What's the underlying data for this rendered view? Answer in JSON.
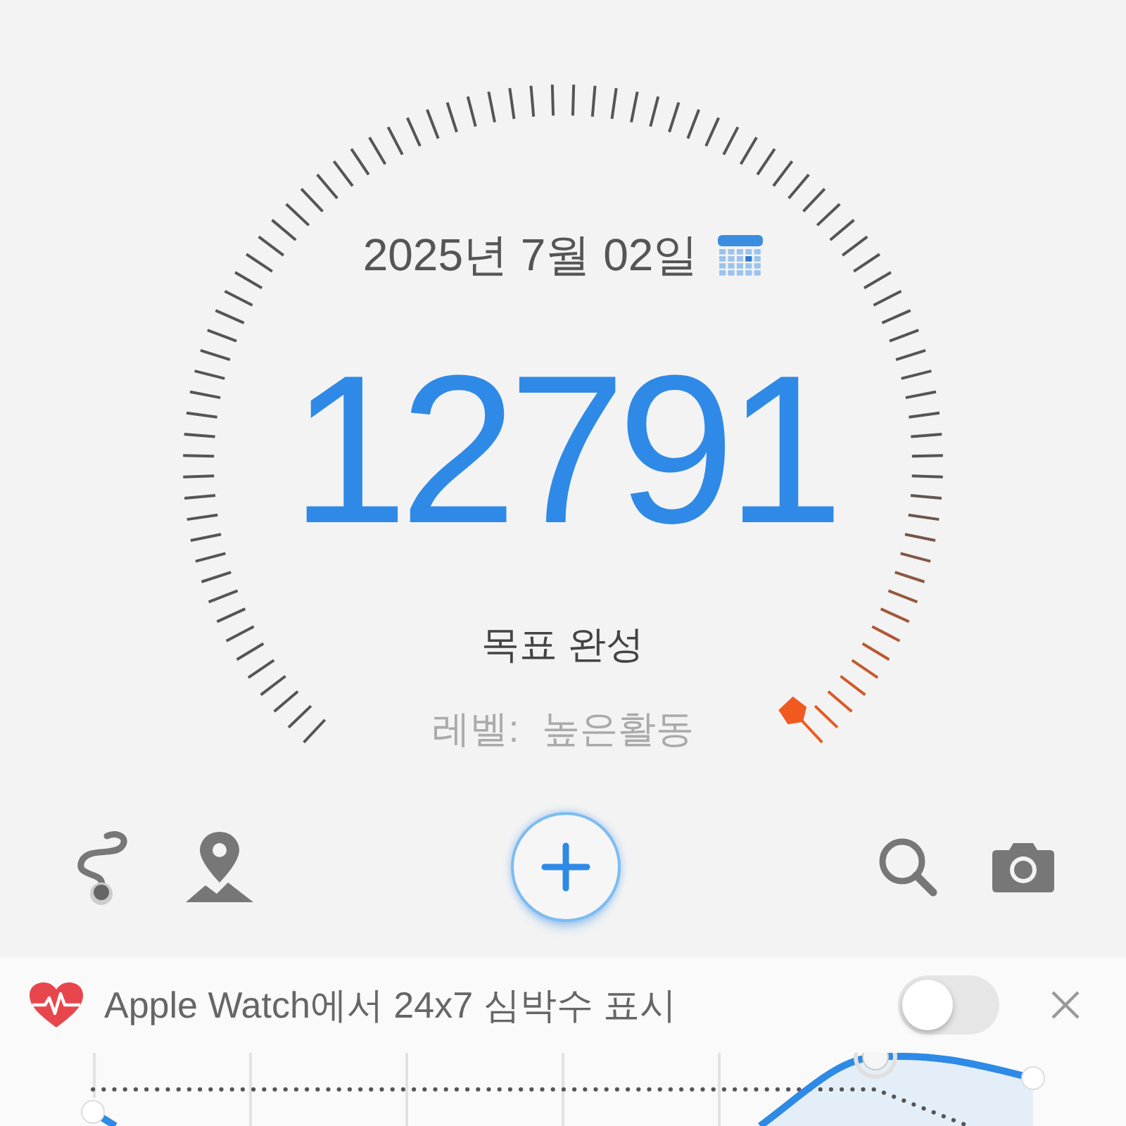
{
  "gauge": {
    "date": "2025년 7월 02일",
    "steps": "12791",
    "status": "목표 완성",
    "level_label": "레벨:",
    "level_value": "높은활동"
  },
  "toolbar": {
    "add_button_selected": true
  },
  "banner": {
    "text": "Apple Watch에서 24x7 심박수 표시",
    "toggle_on": false
  }
}
